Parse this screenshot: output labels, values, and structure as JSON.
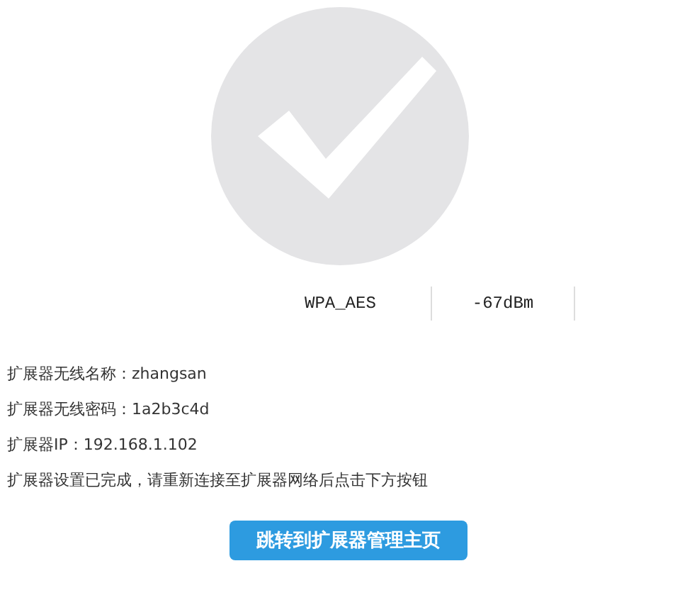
{
  "status_row": {
    "cells": [
      "WPA_AES",
      "-67dBm"
    ]
  },
  "info_lines": [
    "扩展器无线名称：zhangsan",
    "扩展器无线密码：1a2b3c4d",
    "扩展器IP：192.168.1.102",
    "扩展器设置已完成，请重新连接至扩展器网络后点击下方按钮"
  ],
  "button": {
    "label": "跳转到扩展器管理主页"
  }
}
